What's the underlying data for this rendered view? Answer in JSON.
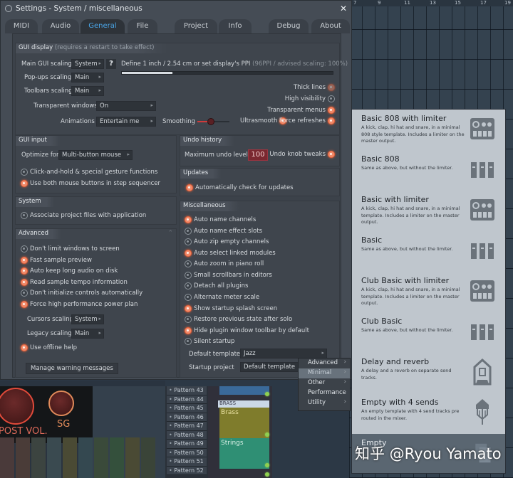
{
  "window": {
    "title": "Settings - System / miscellaneous",
    "close_label": "✕"
  },
  "tabs": [
    {
      "label": "MIDI",
      "active": false
    },
    {
      "label": "Audio",
      "active": false
    },
    {
      "label": "General",
      "active": true
    },
    {
      "label": "File",
      "active": false
    },
    {
      "label": "Project",
      "active": false
    },
    {
      "label": "Info",
      "active": false
    },
    {
      "label": "Debug",
      "active": false
    },
    {
      "label": "About",
      "active": false
    }
  ],
  "gui_display": {
    "title": "GUI display",
    "subtitle": "(requires a restart to take effect)",
    "main_scaling_label": "Main GUI scaling",
    "main_scaling_value": "System",
    "help_label": "?",
    "popups_scaling_label": "Pop-ups scaling",
    "popups_scaling_value": "Main",
    "toolbars_scaling_label": "Toolbars scaling",
    "toolbars_scaling_value": "Main",
    "ppi_label": "Define 1 inch / 2.54 cm or set display's PPI",
    "ppi_hint": "(96PPI / advised scaling: 100%)",
    "ppi_slider_fraction": 0.24,
    "transparent_windows_label": "Transparent windows",
    "transparent_windows_value": "On",
    "animations_label": "Animations",
    "animations_value": "Entertain me",
    "smoothing_label": "Smoothing",
    "thick_lines": {
      "label": "Thick lines",
      "on": true,
      "disabled": true
    },
    "high_visibility": {
      "label": "High visibility",
      "on": false
    },
    "transparent_menus": {
      "label": "Transparent menus",
      "on": true
    },
    "ultrasmooth": {
      "label": "Ultrasmooth",
      "on": true
    },
    "force_refreshes": {
      "label": "Force refreshes",
      "on": true
    }
  },
  "gui_input": {
    "title": "GUI input",
    "optimize_label": "Optimize for",
    "optimize_value": "Multi-button mouse",
    "options": [
      {
        "label": "Click-and-hold & special gesture functions",
        "on": false
      },
      {
        "label": "Use both mouse buttons in step sequencer",
        "on": true
      }
    ]
  },
  "undo_history": {
    "title": "Undo history",
    "max_levels_label": "Maximum undo levels",
    "max_levels_value": "100",
    "knob_tweaks": {
      "label": "Undo knob tweaks",
      "on": true
    }
  },
  "updates": {
    "title": "Updates",
    "auto_check": {
      "label": "Automatically check for updates",
      "on": true
    }
  },
  "system": {
    "title": "System",
    "associate": {
      "label": "Associate project files with application",
      "on": false
    }
  },
  "advanced": {
    "title": "Advanced",
    "options": [
      {
        "label": "Don't limit windows to screen",
        "on": false
      },
      {
        "label": "Fast sample preview",
        "on": true
      },
      {
        "label": "Auto keep long audio on disk",
        "on": true
      },
      {
        "label": "Read sample tempo information",
        "on": true
      },
      {
        "label": "Don't initialize controls automatically",
        "on": false
      },
      {
        "label": "Force high performance power plan",
        "on": true
      }
    ],
    "cursors_scaling_label": "Cursors scaling",
    "cursors_scaling_value": "System",
    "legacy_scaling_label": "Legacy scaling",
    "legacy_scaling_value": "Main",
    "offline_help": {
      "label": "Use offline help",
      "on": true
    },
    "manage_warnings_label": "Manage warning messages"
  },
  "misc": {
    "title": "Miscellaneous",
    "options": [
      {
        "label": "Auto name channels",
        "on": true
      },
      {
        "label": "Auto name effect slots",
        "on": false
      },
      {
        "label": "Auto zip empty channels",
        "on": false
      },
      {
        "label": "Auto select linked modules",
        "on": true
      },
      {
        "label": "Auto zoom in piano roll",
        "on": false
      },
      {
        "label": "Small scrollbars in editors",
        "on": false
      },
      {
        "label": "Detach all plugins",
        "on": false
      },
      {
        "label": "Alternate meter scale",
        "on": false
      },
      {
        "label": "Show startup splash screen",
        "on": true
      },
      {
        "label": "Restore previous state after solo",
        "on": false
      },
      {
        "label": "Hide plugin window toolbar by default",
        "on": true
      },
      {
        "label": "Silent startup",
        "on": false
      }
    ],
    "default_template_label": "Default template",
    "default_template_value": "Jazz",
    "startup_project_label": "Startup project",
    "startup_project_value": "Default template"
  },
  "submenu": {
    "items": [
      {
        "label": "Advanced",
        "highlighted": false
      },
      {
        "label": "Minimal",
        "highlighted": true
      },
      {
        "label": "Other",
        "highlighted": false
      },
      {
        "label": "Performance",
        "highlighted": false
      },
      {
        "label": "Utility",
        "highlighted": false
      }
    ]
  },
  "templates": [
    {
      "name": "Basic 808 with limiter",
      "desc": "A kick, clap, hi hat and snare, in a minimal 808 style template. Includes a limiter on the master output.",
      "icon": "drum-machine-icon"
    },
    {
      "name": "Basic 808",
      "desc": "Same as above, but without the limiter.",
      "icon": "mixer-faders-icon"
    },
    {
      "name": "Basic with limiter",
      "desc": "A kick, clap, hi hat and snare, in a minimal template. Includes a limiter on the master output.",
      "icon": "drum-machine-icon"
    },
    {
      "name": "Basic",
      "desc": "Same as above, but without the limiter.",
      "icon": "mixer-faders-icon"
    },
    {
      "name": "Club Basic with limiter",
      "desc": "A kick, clap, hi hat and snare, in a minimal template. Includes a limiter on the master output.",
      "icon": "drum-machine-icon"
    },
    {
      "name": "Club Basic",
      "desc": "Same as above, but without the limiter.",
      "icon": "mixer-faders-icon"
    },
    {
      "name": "Delay and reverb",
      "desc": "A delay and a reverb on separate send tracks.",
      "icon": "send-routing-icon"
    },
    {
      "name": "Empty with 4 sends",
      "desc": "An empty template with 4 send tracks pre routed in the mixer.",
      "icon": "send-fork-icon"
    },
    {
      "name": "Empty",
      "desc": "",
      "icon": "document-copy-icon",
      "selected": true
    }
  ],
  "background": {
    "ruler_ticks": [
      "7",
      "9",
      "11",
      "13",
      "15",
      "17",
      "19"
    ],
    "mixer_knobs": [
      "POST VOL.",
      "SG"
    ],
    "patterns": [
      "Pattern 43",
      "Pattern 44",
      "Pattern 45",
      "Pattern 46",
      "Pattern 47",
      "Pattern 48",
      "Pattern 49",
      "Pattern 50",
      "Pattern 51",
      "Pattern 52"
    ],
    "channel_group": "BRASS",
    "channels": [
      "Brass",
      "Strings"
    ]
  },
  "watermark": "知乎 @Ryou Yamato"
}
